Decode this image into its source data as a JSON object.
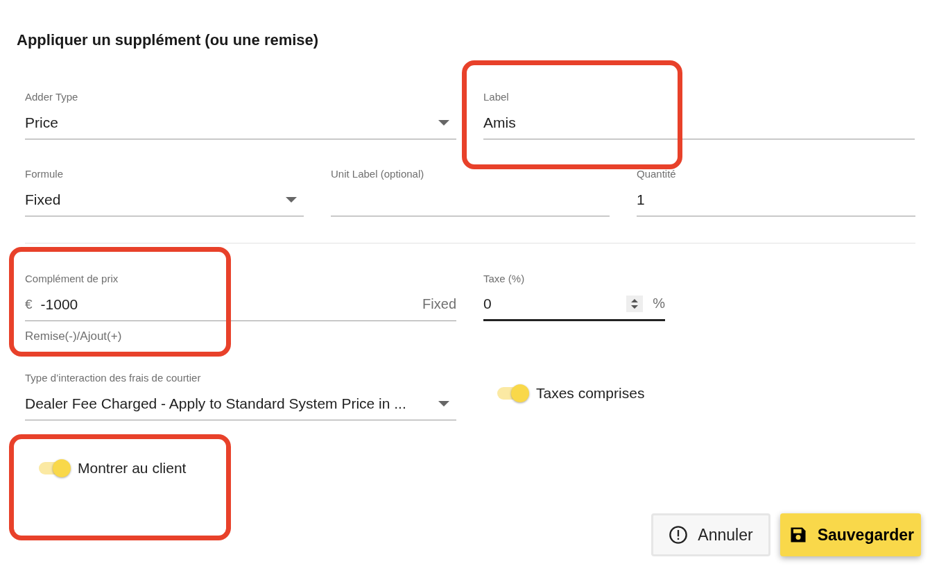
{
  "title": "Appliquer un supplément (ou une remise)",
  "rows": [
    [
      {
        "kind": "select",
        "label": "Adder Type",
        "value": "Price"
      },
      {
        "kind": "text",
        "label": "Label",
        "value": "Amis"
      }
    ],
    [
      {
        "kind": "select",
        "label": "Formule",
        "value": "Fixed"
      },
      {
        "kind": "text",
        "label": "Unit Label (optional)"
      },
      {
        "kind": "text",
        "label": "Quantité",
        "value": "1"
      }
    ]
  ],
  "price_addon": {
    "label": "Complément de prix",
    "prefix": "€",
    "value": "-1000",
    "suffix": "Fixed",
    "helper": "Remise(-)/Ajout(+)"
  },
  "tax": {
    "label": "Taxe (%)",
    "value": "0",
    "unit": "%",
    "focused": true
  },
  "broker_interaction": {
    "label": "Type d’interaction des frais de courtier",
    "value": "Dealer Fee Charged - Apply to Standard System Price in ..."
  },
  "tax_included": {
    "label": "Taxes comprises",
    "on": true
  },
  "show_client": {
    "label": "Montrer au client",
    "on": true
  },
  "buttons": [
    {
      "kind": "cancel",
      "label": "Annuler"
    },
    {
      "kind": "save",
      "label": "Sauvegarder"
    }
  ]
}
